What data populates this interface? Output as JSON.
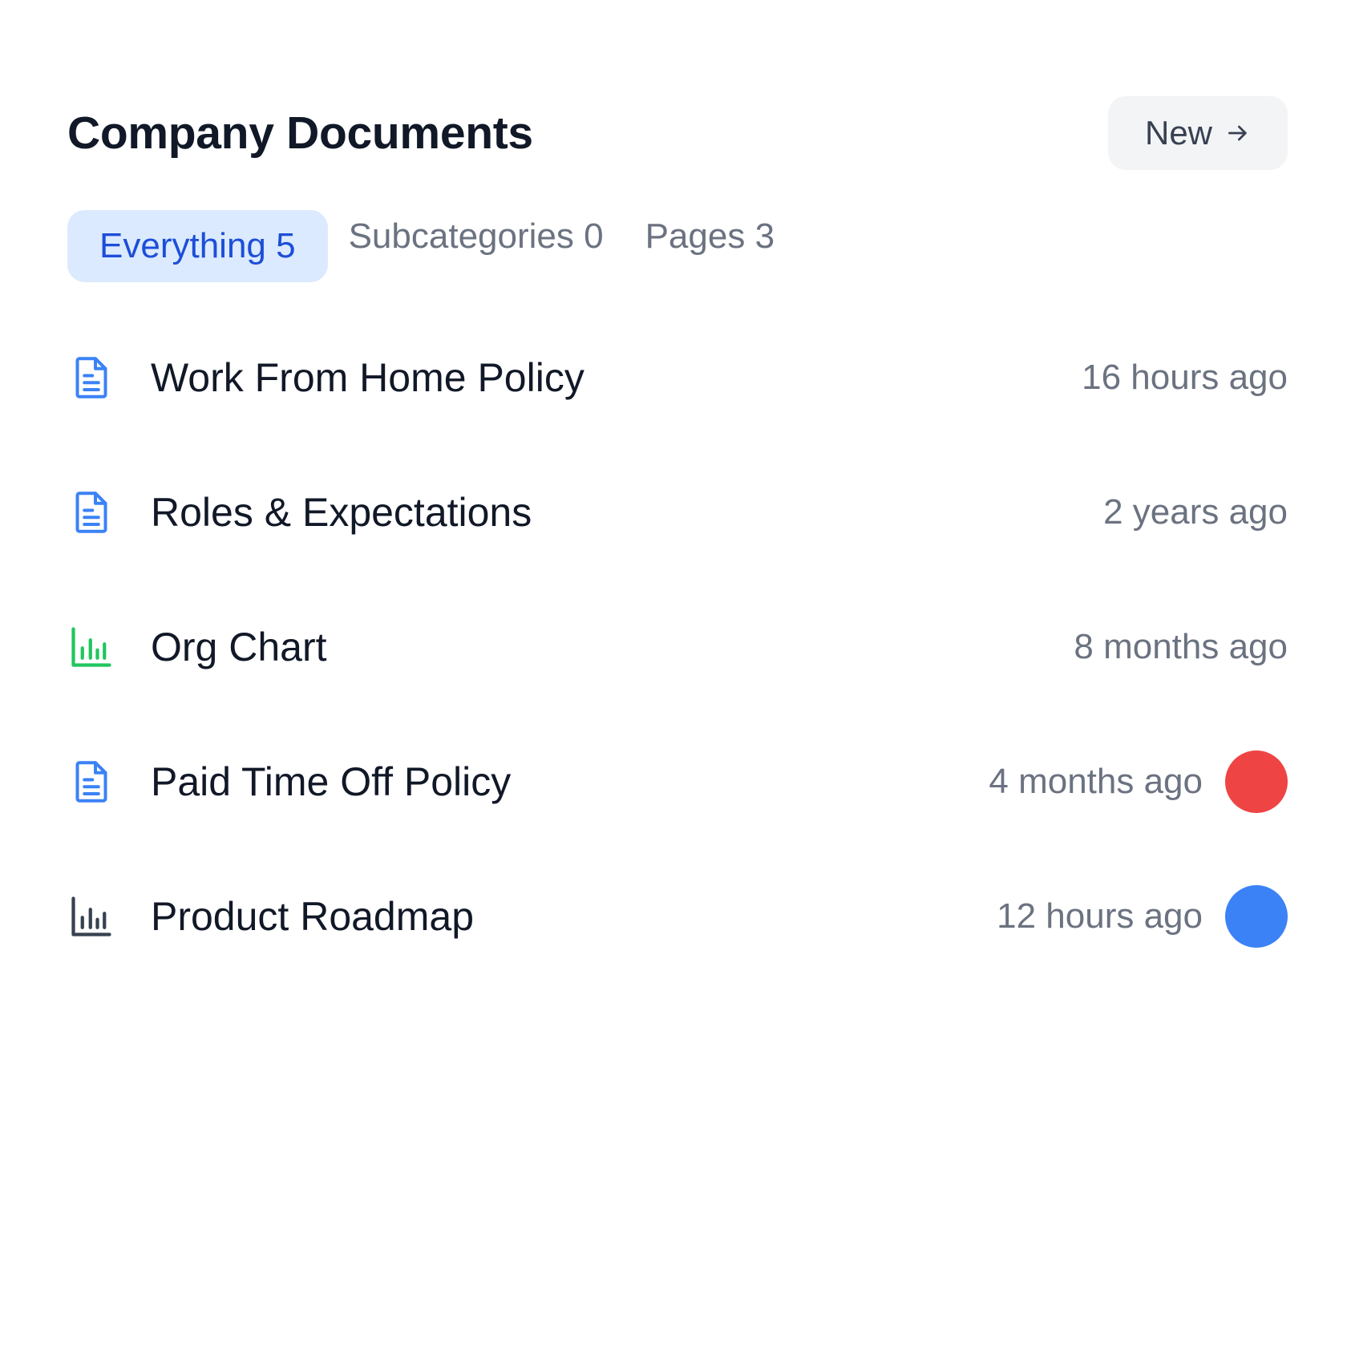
{
  "header": {
    "title": "Company Documents",
    "new_button_label": "New"
  },
  "tabs": [
    {
      "label": "Everything 5",
      "active": true
    },
    {
      "label": "Subcategories 0",
      "active": false
    },
    {
      "label": "Pages 3",
      "active": false
    }
  ],
  "documents": [
    {
      "title": "Work From Home Policy",
      "time": "16 hours ago",
      "icon": "document-icon",
      "icon_color": "#3b82f6"
    },
    {
      "title": "Roles & Expectations",
      "time": "2 years ago",
      "icon": "document-icon",
      "icon_color": "#3b82f6"
    },
    {
      "title": "Org Chart",
      "time": "8 months ago",
      "icon": "bar-chart-icon",
      "icon_color": "#22c55e"
    },
    {
      "title": "Paid Time Off Policy",
      "time": "4 months ago",
      "icon": "document-icon",
      "icon_color": "#3b82f6",
      "avatar_color": "#ef4444"
    },
    {
      "title": "Product Roadmap",
      "time": "12 hours ago",
      "icon": "bar-chart-icon",
      "icon_color": "#374151",
      "avatar_color": "#3b82f6"
    }
  ]
}
